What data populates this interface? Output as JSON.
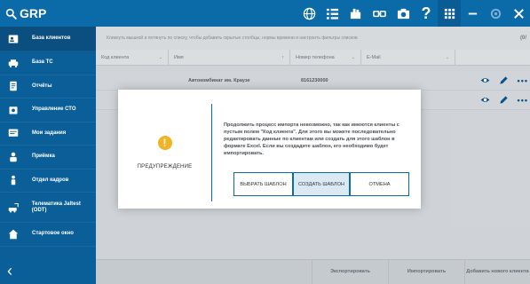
{
  "app": {
    "logo": "GRP"
  },
  "topbar": {
    "icons": [
      "globe-icon",
      "list-icon",
      "tray-icon",
      "link-icon",
      "camera-icon",
      "help-icon",
      "grid-icon",
      "minimize-icon",
      "settings-icon",
      "close-icon"
    ],
    "help_label": "?",
    "minimize_label": "—",
    "close_label": "✕"
  },
  "sidebar": {
    "items": [
      {
        "label": "База клиентов",
        "icon": "clients-icon"
      },
      {
        "label": "База ТС",
        "icon": "car-icon"
      },
      {
        "label": "Отчёты",
        "icon": "report-icon"
      },
      {
        "label": "Управление СТО",
        "icon": "service-icon"
      },
      {
        "label": "Мои задания",
        "icon": "tasks-icon"
      },
      {
        "label": "Приёмка",
        "icon": "reception-icon"
      },
      {
        "label": "Отдел кадров",
        "icon": "hr-icon"
      },
      {
        "label": "Телематика Jaltest (ODT)",
        "icon": "telematics-icon"
      },
      {
        "label": "Стартовое окно",
        "icon": "home-icon"
      }
    ],
    "back_label": "‹"
  },
  "main": {
    "hint": "Кликнуть мышкой и потянуть по списку, чтобы добавить скрытые столбцы, нормы времени и настроить фильтры списков",
    "hint_right": "(0/",
    "columns": [
      {
        "label": "Код клиента"
      },
      {
        "label": "Имя"
      },
      {
        "label": "Номер телефона"
      },
      {
        "label": "E-Mail"
      }
    ],
    "rows": [
      {
        "code": "",
        "name": "Автокомбинат им. Краузе",
        "phone": "8161230000"
      },
      {
        "code": "",
        "name": "",
        "phone": ""
      }
    ],
    "row_more": "•••",
    "bottom_buttons": [
      "Экспортировать",
      "Импортировать",
      "Добавить нового клиента"
    ]
  },
  "dialog": {
    "icon": "warning-icon",
    "icon_glyph": "!",
    "title": "ПРЕДУПРЕЖДЕНИЕ",
    "message": "Продолжить процесс импорта невозможно, так как имеются клиенты с пустым полем \"Код клиента\". Для этого вы можете последовательно редактировать данные по клиентам или создать для этого шаблон в формате Excel. Если вы создадите шаблон, его необходимо будет импортировать.",
    "buttons": {
      "choose": "ВЫБРАТЬ ШАБЛОН",
      "create": "СОЗДАТЬ ШАБЛОН",
      "cancel": "ОТМЕНА"
    }
  },
  "colors": {
    "brand": "#0b6aa8",
    "sidebar": "#0b5f98",
    "warning": "#f0b323"
  }
}
